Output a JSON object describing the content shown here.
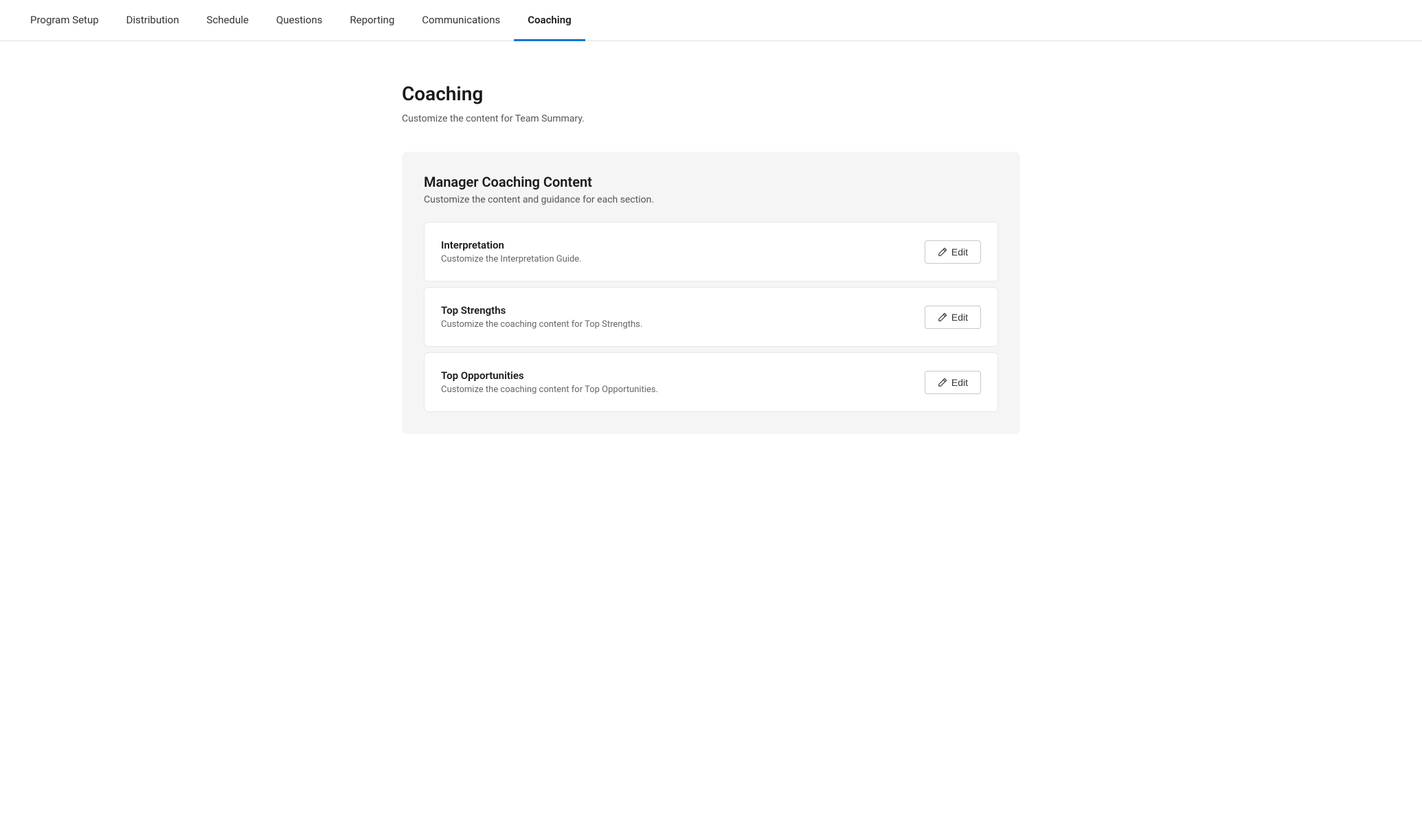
{
  "nav": {
    "items": [
      {
        "id": "program-setup",
        "label": "Program Setup",
        "active": false
      },
      {
        "id": "distribution",
        "label": "Distribution",
        "active": false
      },
      {
        "id": "schedule",
        "label": "Schedule",
        "active": false
      },
      {
        "id": "questions",
        "label": "Questions",
        "active": false
      },
      {
        "id": "reporting",
        "label": "Reporting",
        "active": false
      },
      {
        "id": "communications",
        "label": "Communications",
        "active": false
      },
      {
        "id": "coaching",
        "label": "Coaching",
        "active": true
      }
    ]
  },
  "page": {
    "title": "Coaching",
    "subtitle": "Customize the content for Team Summary."
  },
  "coaching_section": {
    "title": "Manager Coaching Content",
    "subtitle": "Customize the content and guidance for each section.",
    "cards": [
      {
        "id": "interpretation",
        "title": "Interpretation",
        "description": "Customize the Interpretation Guide.",
        "edit_label": "Edit"
      },
      {
        "id": "top-strengths",
        "title": "Top Strengths",
        "description": "Customize the coaching content for Top Strengths.",
        "edit_label": "Edit"
      },
      {
        "id": "top-opportunities",
        "title": "Top Opportunities",
        "description": "Customize the coaching content for Top Opportunities.",
        "edit_label": "Edit"
      }
    ]
  },
  "colors": {
    "active_nav_underline": "#0078d4"
  }
}
